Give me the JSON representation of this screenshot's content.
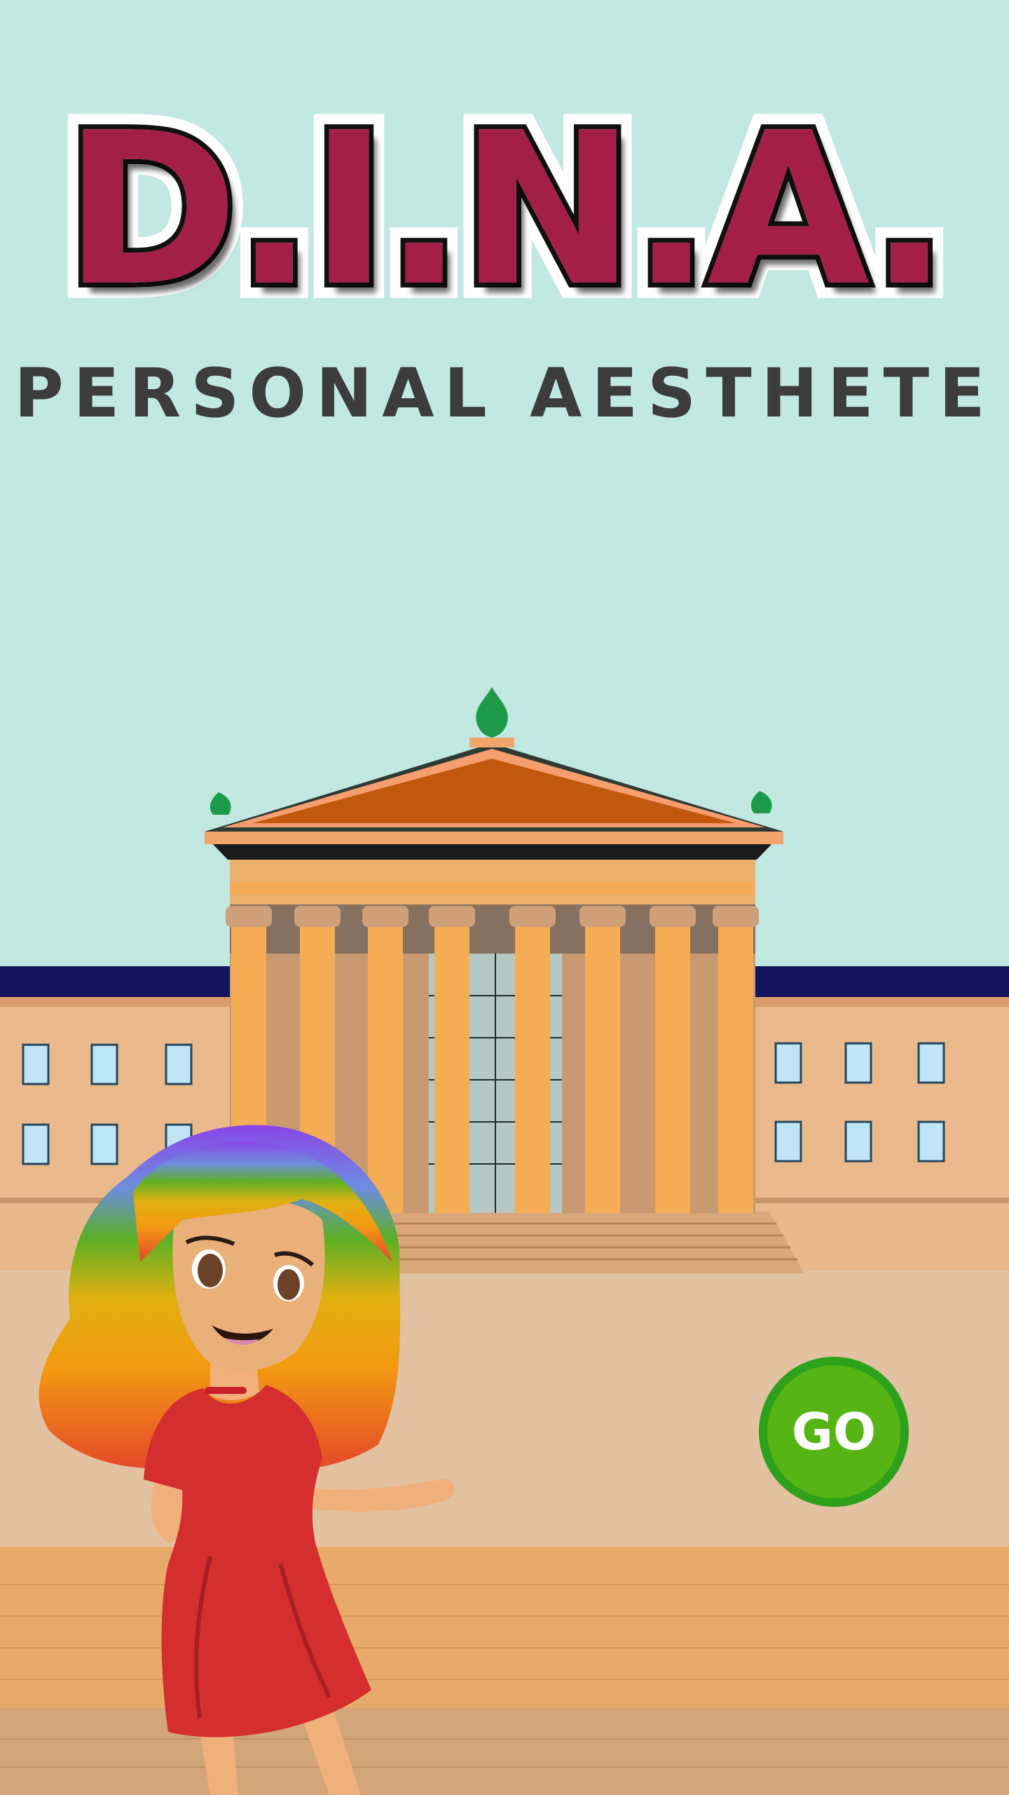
{
  "app": {
    "logo_text": "D.I.N.A.",
    "subtitle": "PERSONAL AESTHETE"
  },
  "go_button": {
    "label": "GO"
  },
  "colors": {
    "sky": "#c2e8e2",
    "logo_fill": "#a31f48",
    "go_button": "#56b414",
    "building": "#f5ad55",
    "roof": "#c1580d",
    "dress": "#d42e2e"
  },
  "icons": {
    "mascot": "rainbow-haired-girl-illustration",
    "landmark": "museum-building-illustration"
  }
}
